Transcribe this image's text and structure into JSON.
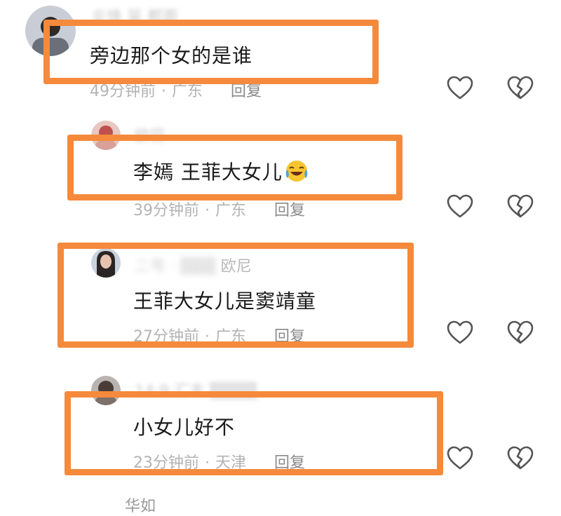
{
  "comments": [
    {
      "username": "炎焕 吴 都面",
      "text": "旁边那个女的是谁",
      "time": "49分钟前",
      "location": "广东",
      "reply_label": "回复"
    },
    {
      "username": "欧巴",
      "text": "李嫣 王菲大女儿",
      "time": "39分钟前",
      "location": "广东",
      "reply_label": "回复",
      "emoji": "laughing-crying-emoji"
    },
    {
      "username": "二号 · ▒▒▒ 欧尼",
      "username_visible_suffix": "欧尼",
      "text": "王菲大女儿是窦靖童",
      "time": "27分钟前",
      "location": "广东",
      "reply_label": "回复"
    },
    {
      "username": "14·9 汇丰 ▒▒▒▒",
      "text": "小女儿好不",
      "time": "23分钟前",
      "location": "天津",
      "reply_label": "回复"
    }
  ],
  "partial_next_username": "华如",
  "icons": {
    "like": "heart-outline-icon",
    "dislike": "broken-heart-icon"
  },
  "colors": {
    "highlight": "#f58a3c",
    "meta_text": "#b3b3b3",
    "main_text": "#1a1a1a",
    "icon_stroke": "#555555"
  }
}
